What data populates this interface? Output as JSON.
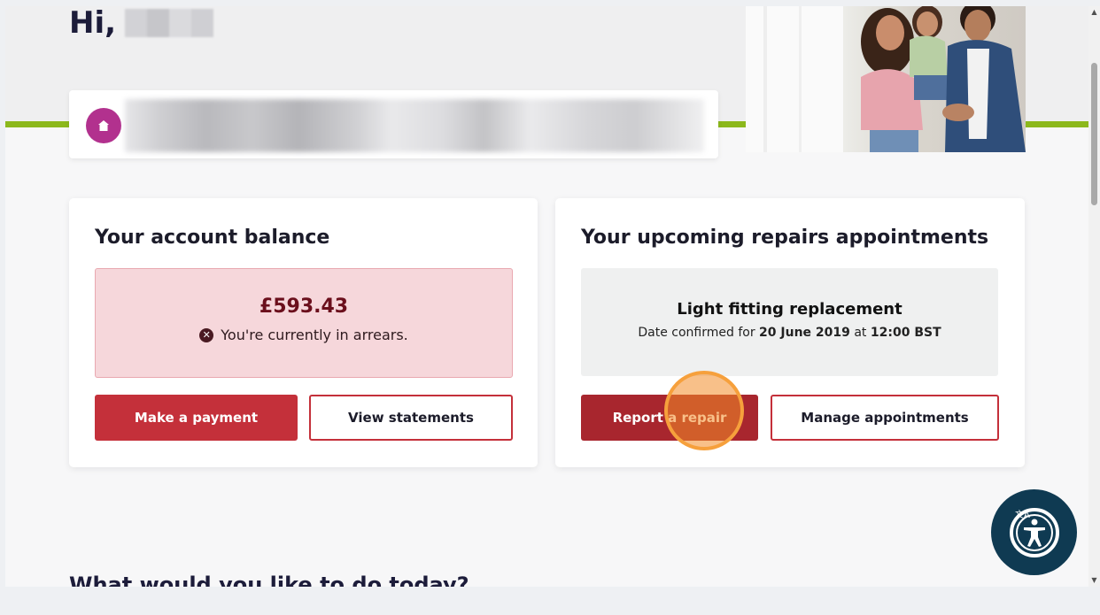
{
  "header": {
    "greeting": "Hi,"
  },
  "balance_card": {
    "title": "Your account balance",
    "amount": "£593.43",
    "status": "You're currently in arrears.",
    "make_payment_label": "Make a payment",
    "view_statements_label": "View statements"
  },
  "repairs_card": {
    "title": "Your upcoming repairs appointments",
    "repair_title": "Light fitting replacement",
    "date_prefix": "Date confirmed for",
    "date": "20 June 2019",
    "at": "at",
    "time": "12:00 BST",
    "report_repair_label": "Report a repair",
    "manage_appointments_label": "Manage appointments"
  },
  "main": {
    "section_heading": "What would you like to do today?"
  },
  "colors": {
    "brand_red": "#c4303a",
    "accent_green": "#8cb81c",
    "home_badge": "#b2318e",
    "a11y_navy": "#0f3a52"
  },
  "icons": [
    "home-icon",
    "error-circle-icon",
    "accessibility-icon",
    "translate-icon"
  ]
}
